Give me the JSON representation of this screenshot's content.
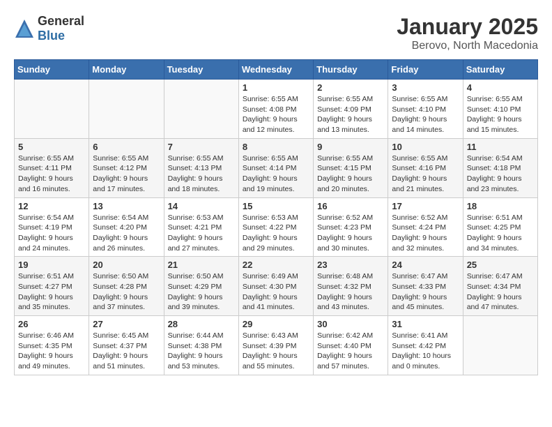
{
  "logo": {
    "text_general": "General",
    "text_blue": "Blue"
  },
  "title": "January 2025",
  "subtitle": "Berovo, North Macedonia",
  "days_of_week": [
    "Sunday",
    "Monday",
    "Tuesday",
    "Wednesday",
    "Thursday",
    "Friday",
    "Saturday"
  ],
  "weeks": [
    [
      {
        "day": "",
        "info": ""
      },
      {
        "day": "",
        "info": ""
      },
      {
        "day": "",
        "info": ""
      },
      {
        "day": "1",
        "info": "Sunrise: 6:55 AM\nSunset: 4:08 PM\nDaylight: 9 hours and 12 minutes."
      },
      {
        "day": "2",
        "info": "Sunrise: 6:55 AM\nSunset: 4:09 PM\nDaylight: 9 hours and 13 minutes."
      },
      {
        "day": "3",
        "info": "Sunrise: 6:55 AM\nSunset: 4:10 PM\nDaylight: 9 hours and 14 minutes."
      },
      {
        "day": "4",
        "info": "Sunrise: 6:55 AM\nSunset: 4:10 PM\nDaylight: 9 hours and 15 minutes."
      }
    ],
    [
      {
        "day": "5",
        "info": "Sunrise: 6:55 AM\nSunset: 4:11 PM\nDaylight: 9 hours and 16 minutes."
      },
      {
        "day": "6",
        "info": "Sunrise: 6:55 AM\nSunset: 4:12 PM\nDaylight: 9 hours and 17 minutes."
      },
      {
        "day": "7",
        "info": "Sunrise: 6:55 AM\nSunset: 4:13 PM\nDaylight: 9 hours and 18 minutes."
      },
      {
        "day": "8",
        "info": "Sunrise: 6:55 AM\nSunset: 4:14 PM\nDaylight: 9 hours and 19 minutes."
      },
      {
        "day": "9",
        "info": "Sunrise: 6:55 AM\nSunset: 4:15 PM\nDaylight: 9 hours and 20 minutes."
      },
      {
        "day": "10",
        "info": "Sunrise: 6:55 AM\nSunset: 4:16 PM\nDaylight: 9 hours and 21 minutes."
      },
      {
        "day": "11",
        "info": "Sunrise: 6:54 AM\nSunset: 4:18 PM\nDaylight: 9 hours and 23 minutes."
      }
    ],
    [
      {
        "day": "12",
        "info": "Sunrise: 6:54 AM\nSunset: 4:19 PM\nDaylight: 9 hours and 24 minutes."
      },
      {
        "day": "13",
        "info": "Sunrise: 6:54 AM\nSunset: 4:20 PM\nDaylight: 9 hours and 26 minutes."
      },
      {
        "day": "14",
        "info": "Sunrise: 6:53 AM\nSunset: 4:21 PM\nDaylight: 9 hours and 27 minutes."
      },
      {
        "day": "15",
        "info": "Sunrise: 6:53 AM\nSunset: 4:22 PM\nDaylight: 9 hours and 29 minutes."
      },
      {
        "day": "16",
        "info": "Sunrise: 6:52 AM\nSunset: 4:23 PM\nDaylight: 9 hours and 30 minutes."
      },
      {
        "day": "17",
        "info": "Sunrise: 6:52 AM\nSunset: 4:24 PM\nDaylight: 9 hours and 32 minutes."
      },
      {
        "day": "18",
        "info": "Sunrise: 6:51 AM\nSunset: 4:25 PM\nDaylight: 9 hours and 34 minutes."
      }
    ],
    [
      {
        "day": "19",
        "info": "Sunrise: 6:51 AM\nSunset: 4:27 PM\nDaylight: 9 hours and 35 minutes."
      },
      {
        "day": "20",
        "info": "Sunrise: 6:50 AM\nSunset: 4:28 PM\nDaylight: 9 hours and 37 minutes."
      },
      {
        "day": "21",
        "info": "Sunrise: 6:50 AM\nSunset: 4:29 PM\nDaylight: 9 hours and 39 minutes."
      },
      {
        "day": "22",
        "info": "Sunrise: 6:49 AM\nSunset: 4:30 PM\nDaylight: 9 hours and 41 minutes."
      },
      {
        "day": "23",
        "info": "Sunrise: 6:48 AM\nSunset: 4:32 PM\nDaylight: 9 hours and 43 minutes."
      },
      {
        "day": "24",
        "info": "Sunrise: 6:47 AM\nSunset: 4:33 PM\nDaylight: 9 hours and 45 minutes."
      },
      {
        "day": "25",
        "info": "Sunrise: 6:47 AM\nSunset: 4:34 PM\nDaylight: 9 hours and 47 minutes."
      }
    ],
    [
      {
        "day": "26",
        "info": "Sunrise: 6:46 AM\nSunset: 4:35 PM\nDaylight: 9 hours and 49 minutes."
      },
      {
        "day": "27",
        "info": "Sunrise: 6:45 AM\nSunset: 4:37 PM\nDaylight: 9 hours and 51 minutes."
      },
      {
        "day": "28",
        "info": "Sunrise: 6:44 AM\nSunset: 4:38 PM\nDaylight: 9 hours and 53 minutes."
      },
      {
        "day": "29",
        "info": "Sunrise: 6:43 AM\nSunset: 4:39 PM\nDaylight: 9 hours and 55 minutes."
      },
      {
        "day": "30",
        "info": "Sunrise: 6:42 AM\nSunset: 4:40 PM\nDaylight: 9 hours and 57 minutes."
      },
      {
        "day": "31",
        "info": "Sunrise: 6:41 AM\nSunset: 4:42 PM\nDaylight: 10 hours and 0 minutes."
      },
      {
        "day": "",
        "info": ""
      }
    ]
  ]
}
